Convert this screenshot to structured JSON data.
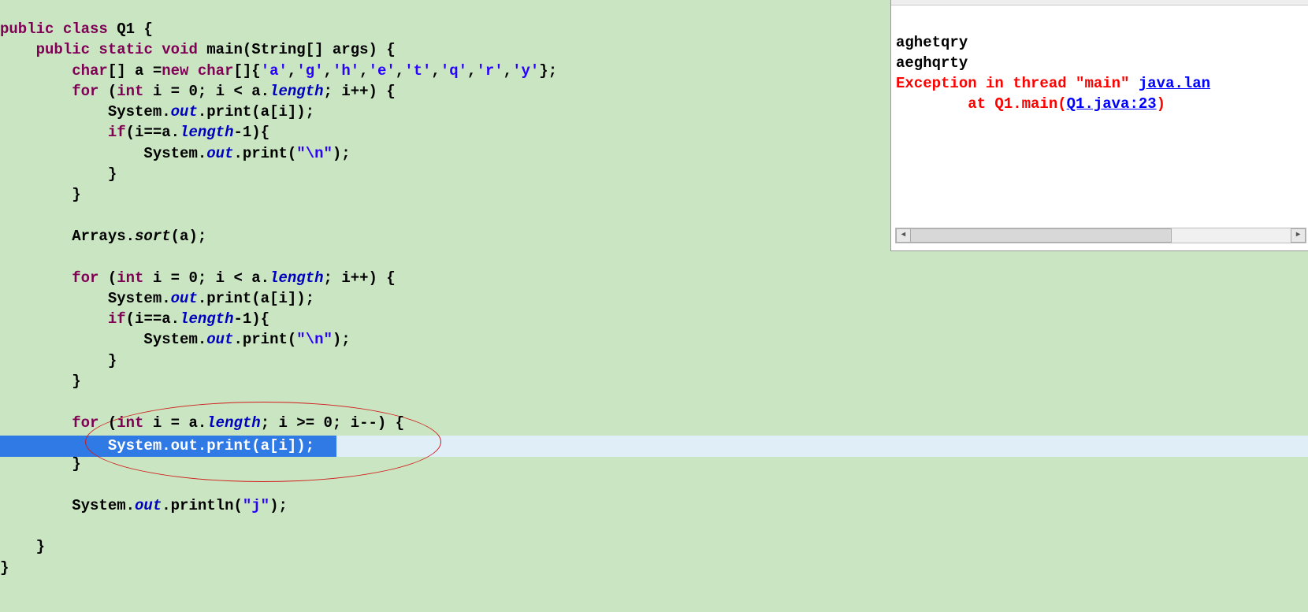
{
  "code": {
    "l1a": "public",
    "l1b": " class",
    "l1c": " Q1 {",
    "l2a": "    public",
    "l2b": " static",
    "l2c": " void",
    "l2d": " main(String[] args) {",
    "l3a": "        char",
    "l3b": "[] a =",
    "l3c": "new",
    "l3d": " char",
    "l3e": "[]{",
    "l3f": "'a'",
    "l3g": ",",
    "l3h": "'g'",
    "l3i": ",",
    "l3j": "'h'",
    "l3k": ",",
    "l3l": "'e'",
    "l3m": ",",
    "l3n": "'t'",
    "l3o": ",",
    "l3p": "'q'",
    "l3q": ",",
    "l3r": "'r'",
    "l3s": ",",
    "l3t": "'y'",
    "l3u": "};",
    "l4a": "        for",
    "l4b": " (",
    "l4c": "int",
    "l4d": " i = 0; i < a.",
    "l4e": "length",
    "l4f": "; i++) {",
    "l5a": "            System.",
    "l5b": "out",
    "l5c": ".print(a[i]);",
    "l6a": "            if",
    "l6b": "(i==a.",
    "l6c": "length",
    "l6d": "-1){",
    "l7a": "                System.",
    "l7b": "out",
    "l7c": ".print(",
    "l7d": "\"\\n\"",
    "l7e": ");",
    "l8": "            }",
    "l9": "        }",
    "l10": "",
    "l11a": "        Arrays.",
    "l11b": "sort",
    "l11c": "(a);",
    "l12": "",
    "l13a": "        for",
    "l13b": " (",
    "l13c": "int",
    "l13d": " i = 0; i < a.",
    "l13e": "length",
    "l13f": "; i++) {",
    "l14a": "            System.",
    "l14b": "out",
    "l14c": ".print(a[i]);",
    "l15a": "            if",
    "l15b": "(i==a.",
    "l15c": "length",
    "l15d": "-1){",
    "l16a": "                System.",
    "l16b": "out",
    "l16c": ".print(",
    "l16d": "\"\\n\"",
    "l16e": ");",
    "l17": "            }",
    "l18": "        }",
    "l19": "",
    "l20a": "        for",
    "l20b": " (",
    "l20c": "int",
    "l20d": " i = a.",
    "l20e": "length",
    "l20f": "; i >= 0; i--) {",
    "l21sel": "            System.out.print(a[i]);",
    "l22": "        }",
    "l23": "",
    "l24a": "        System.",
    "l24b": "out",
    "l24c": ".println(",
    "l24d": "\"j\"",
    "l24e": ");",
    "l25": "",
    "l26": "    }",
    "l27": "}"
  },
  "console": {
    "out1": "aghetqry",
    "out2": "aeghqrty",
    "err1a": "Exception in thread \"main\" ",
    "err1b": "java.lan",
    "err2a": "\tat Q1.main(",
    "err2b": "Q1.java:23",
    "err2c": ")"
  }
}
